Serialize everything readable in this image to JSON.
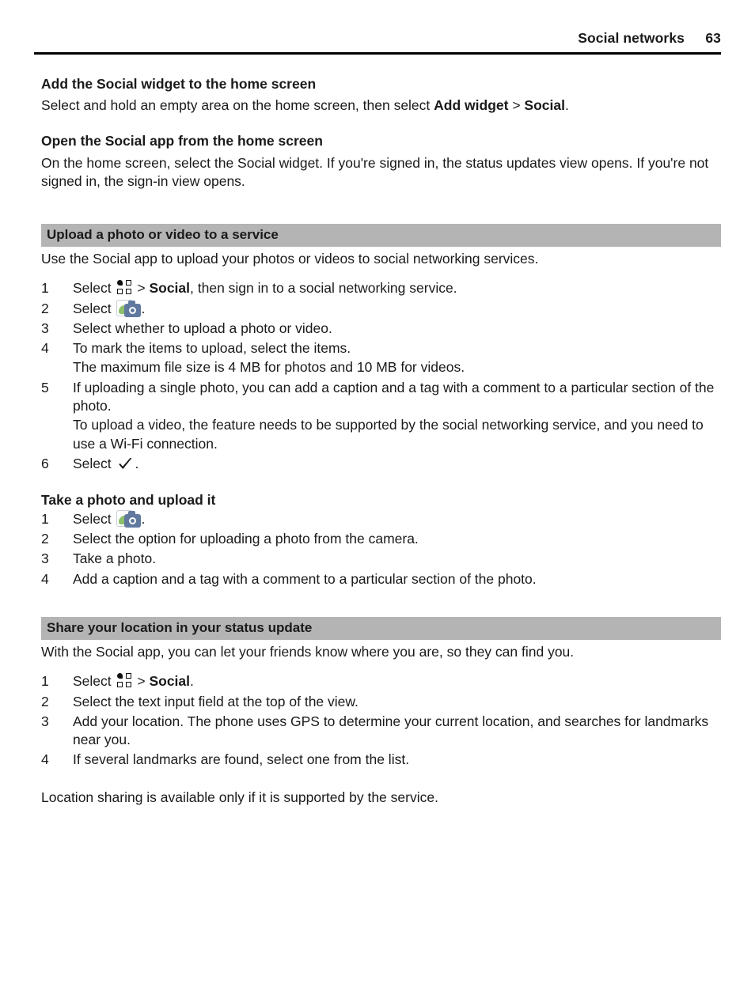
{
  "header": {
    "title": "Social networks",
    "page_number": "63"
  },
  "sections": [
    {
      "type": "subhead",
      "heading": "Add the Social widget to the home screen",
      "body_pre": "Select and hold an empty area on the home screen, then select ",
      "body_bold1": "Add widget",
      "body_mid": " > ",
      "body_bold2": "Social",
      "body_post": "."
    },
    {
      "type": "subhead",
      "heading": "Open the Social app from the home screen",
      "body": "On the home screen, select the Social widget. If you're signed in, the status updates view opens. If you're not signed in, the sign-in view opens."
    }
  ],
  "upload_section": {
    "band_title": "Upload a photo or video to a service",
    "intro": "Use the Social app to upload your photos or videos to social networking services.",
    "steps": [
      {
        "num": "1",
        "pre": "Select ",
        "icon": "grid-menu-icon",
        "mid": " > ",
        "bold": "Social",
        "post": ", then sign in to a social networking service."
      },
      {
        "num": "2",
        "pre": "Select ",
        "icon": "camera-icon",
        "post": "."
      },
      {
        "num": "3",
        "pre": "Select whether to upload a photo or video."
      },
      {
        "num": "4",
        "pre": "To mark the items to upload, select the items.",
        "sub": "The maximum file size is 4 MB for photos and 10 MB for videos."
      },
      {
        "num": "5",
        "pre": "If uploading a single photo, you can add a caption and a tag with a comment to a particular section of the photo.",
        "sub": "To upload a video, the feature needs to be supported by the social networking service, and you need to use a Wi-Fi connection."
      },
      {
        "num": "6",
        "pre": "Select ",
        "icon": "check-icon",
        "post": "."
      }
    ]
  },
  "take_photo_section": {
    "heading": "Take a photo and upload it",
    "steps": [
      {
        "num": "1",
        "pre": "Select ",
        "icon": "camera-icon",
        "post": "."
      },
      {
        "num": "2",
        "pre": "Select the option for uploading a photo from the camera."
      },
      {
        "num": "3",
        "pre": "Take a photo."
      },
      {
        "num": "4",
        "pre": "Add a caption and a tag with a comment to a particular section of the photo."
      }
    ]
  },
  "location_section": {
    "band_title": "Share your location in your status update",
    "intro": "With the Social app, you can let your friends know where you are, so they can find you.",
    "steps": [
      {
        "num": "1",
        "pre": "Select ",
        "icon": "grid-menu-icon",
        "mid": " > ",
        "bold": "Social",
        "post": "."
      },
      {
        "num": "2",
        "pre": "Select the text input field at the top of the view."
      },
      {
        "num": "3",
        "pre": "Add your location. The phone uses GPS to determine your current location, and searches for landmarks near you."
      },
      {
        "num": "4",
        "pre": "If several landmarks are found, select one from the list."
      }
    ],
    "footer_note": "Location sharing is available only if it is supported by the service."
  },
  "colors": {
    "band_gray": "#b4b4b4",
    "camera_body": "#61799f",
    "camera_leaf": "#8cc06a",
    "text": "#1a1a1a"
  }
}
